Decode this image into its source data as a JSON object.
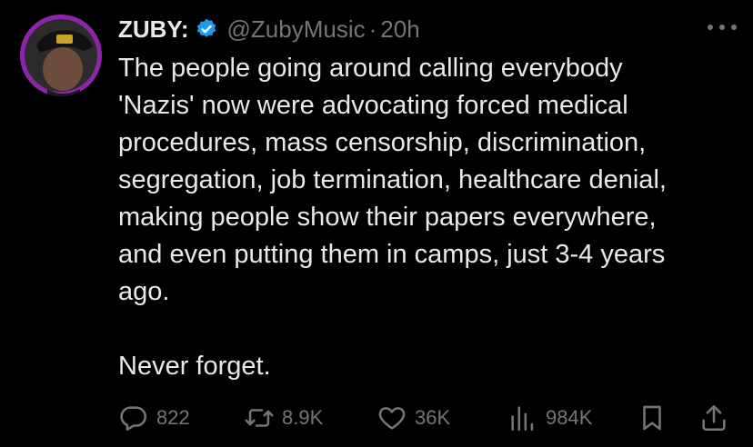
{
  "tweet": {
    "author_name": "ZUBY:",
    "handle": "@ZubyMusic",
    "separator": "·",
    "time": "20h",
    "lines": [
      "The people going around calling everybody",
      "'Nazis' now were advocating forced medical",
      "procedures, mass censorship, discrimination,",
      "segregation, job termination, healthcare denial,",
      "making people show their papers everywhere,",
      "and even putting them in camps, just 3-4 years",
      "ago.",
      "",
      "Never forget."
    ]
  },
  "actions": {
    "replies": "822",
    "retweets": "8.9K",
    "likes": "36K",
    "views": "984K"
  },
  "icons": {
    "verified": "verified-badge-icon",
    "more": "more-icon",
    "reply": "reply-icon",
    "retweet": "retweet-icon",
    "like": "heart-icon",
    "views": "views-icon",
    "bookmark": "bookmark-icon",
    "share": "share-icon"
  },
  "colors": {
    "background": "#000000",
    "text": "#e7e9ea",
    "secondary": "#71767b",
    "verified": "#1d9bf0",
    "avatar_ring": "#7b1fa2"
  }
}
